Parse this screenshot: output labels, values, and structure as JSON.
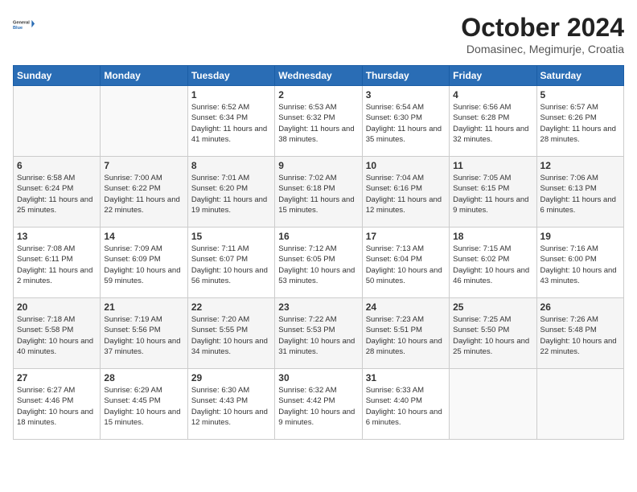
{
  "header": {
    "logo_general": "General",
    "logo_blue": "Blue",
    "month_year": "October 2024",
    "location": "Domasinec, Megimurje, Croatia"
  },
  "days_of_week": [
    "Sunday",
    "Monday",
    "Tuesday",
    "Wednesday",
    "Thursday",
    "Friday",
    "Saturday"
  ],
  "weeks": [
    [
      {
        "day": "",
        "content": ""
      },
      {
        "day": "",
        "content": ""
      },
      {
        "day": "1",
        "content": "Sunrise: 6:52 AM\nSunset: 6:34 PM\nDaylight: 11 hours and 41 minutes."
      },
      {
        "day": "2",
        "content": "Sunrise: 6:53 AM\nSunset: 6:32 PM\nDaylight: 11 hours and 38 minutes."
      },
      {
        "day": "3",
        "content": "Sunrise: 6:54 AM\nSunset: 6:30 PM\nDaylight: 11 hours and 35 minutes."
      },
      {
        "day": "4",
        "content": "Sunrise: 6:56 AM\nSunset: 6:28 PM\nDaylight: 11 hours and 32 minutes."
      },
      {
        "day": "5",
        "content": "Sunrise: 6:57 AM\nSunset: 6:26 PM\nDaylight: 11 hours and 28 minutes."
      }
    ],
    [
      {
        "day": "6",
        "content": "Sunrise: 6:58 AM\nSunset: 6:24 PM\nDaylight: 11 hours and 25 minutes."
      },
      {
        "day": "7",
        "content": "Sunrise: 7:00 AM\nSunset: 6:22 PM\nDaylight: 11 hours and 22 minutes."
      },
      {
        "day": "8",
        "content": "Sunrise: 7:01 AM\nSunset: 6:20 PM\nDaylight: 11 hours and 19 minutes."
      },
      {
        "day": "9",
        "content": "Sunrise: 7:02 AM\nSunset: 6:18 PM\nDaylight: 11 hours and 15 minutes."
      },
      {
        "day": "10",
        "content": "Sunrise: 7:04 AM\nSunset: 6:16 PM\nDaylight: 11 hours and 12 minutes."
      },
      {
        "day": "11",
        "content": "Sunrise: 7:05 AM\nSunset: 6:15 PM\nDaylight: 11 hours and 9 minutes."
      },
      {
        "day": "12",
        "content": "Sunrise: 7:06 AM\nSunset: 6:13 PM\nDaylight: 11 hours and 6 minutes."
      }
    ],
    [
      {
        "day": "13",
        "content": "Sunrise: 7:08 AM\nSunset: 6:11 PM\nDaylight: 11 hours and 2 minutes."
      },
      {
        "day": "14",
        "content": "Sunrise: 7:09 AM\nSunset: 6:09 PM\nDaylight: 10 hours and 59 minutes."
      },
      {
        "day": "15",
        "content": "Sunrise: 7:11 AM\nSunset: 6:07 PM\nDaylight: 10 hours and 56 minutes."
      },
      {
        "day": "16",
        "content": "Sunrise: 7:12 AM\nSunset: 6:05 PM\nDaylight: 10 hours and 53 minutes."
      },
      {
        "day": "17",
        "content": "Sunrise: 7:13 AM\nSunset: 6:04 PM\nDaylight: 10 hours and 50 minutes."
      },
      {
        "day": "18",
        "content": "Sunrise: 7:15 AM\nSunset: 6:02 PM\nDaylight: 10 hours and 46 minutes."
      },
      {
        "day": "19",
        "content": "Sunrise: 7:16 AM\nSunset: 6:00 PM\nDaylight: 10 hours and 43 minutes."
      }
    ],
    [
      {
        "day": "20",
        "content": "Sunrise: 7:18 AM\nSunset: 5:58 PM\nDaylight: 10 hours and 40 minutes."
      },
      {
        "day": "21",
        "content": "Sunrise: 7:19 AM\nSunset: 5:56 PM\nDaylight: 10 hours and 37 minutes."
      },
      {
        "day": "22",
        "content": "Sunrise: 7:20 AM\nSunset: 5:55 PM\nDaylight: 10 hours and 34 minutes."
      },
      {
        "day": "23",
        "content": "Sunrise: 7:22 AM\nSunset: 5:53 PM\nDaylight: 10 hours and 31 minutes."
      },
      {
        "day": "24",
        "content": "Sunrise: 7:23 AM\nSunset: 5:51 PM\nDaylight: 10 hours and 28 minutes."
      },
      {
        "day": "25",
        "content": "Sunrise: 7:25 AM\nSunset: 5:50 PM\nDaylight: 10 hours and 25 minutes."
      },
      {
        "day": "26",
        "content": "Sunrise: 7:26 AM\nSunset: 5:48 PM\nDaylight: 10 hours and 22 minutes."
      }
    ],
    [
      {
        "day": "27",
        "content": "Sunrise: 6:27 AM\nSunset: 4:46 PM\nDaylight: 10 hours and 18 minutes."
      },
      {
        "day": "28",
        "content": "Sunrise: 6:29 AM\nSunset: 4:45 PM\nDaylight: 10 hours and 15 minutes."
      },
      {
        "day": "29",
        "content": "Sunrise: 6:30 AM\nSunset: 4:43 PM\nDaylight: 10 hours and 12 minutes."
      },
      {
        "day": "30",
        "content": "Sunrise: 6:32 AM\nSunset: 4:42 PM\nDaylight: 10 hours and 9 minutes."
      },
      {
        "day": "31",
        "content": "Sunrise: 6:33 AM\nSunset: 4:40 PM\nDaylight: 10 hours and 6 minutes."
      },
      {
        "day": "",
        "content": ""
      },
      {
        "day": "",
        "content": ""
      }
    ]
  ]
}
